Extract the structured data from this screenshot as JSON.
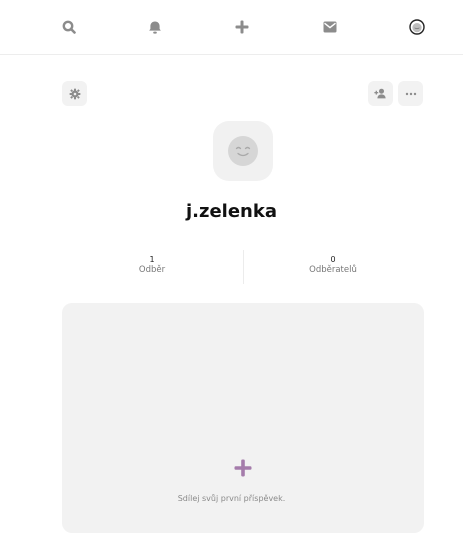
{
  "nav": {
    "items": [
      {
        "icon": "search-icon"
      },
      {
        "icon": "bell-icon"
      },
      {
        "icon": "plus-icon"
      },
      {
        "icon": "mail-icon"
      },
      {
        "icon": "profile-avatar-icon"
      }
    ]
  },
  "profile": {
    "username": "j.zelenka",
    "stats": {
      "following_count": "1",
      "following_label": "Odběr",
      "followers_count": "0",
      "followers_label": "Odběratelů"
    }
  },
  "empty_state": {
    "text": "Sdílej svůj první příspěvek.",
    "accent_color": "#a57cab"
  }
}
